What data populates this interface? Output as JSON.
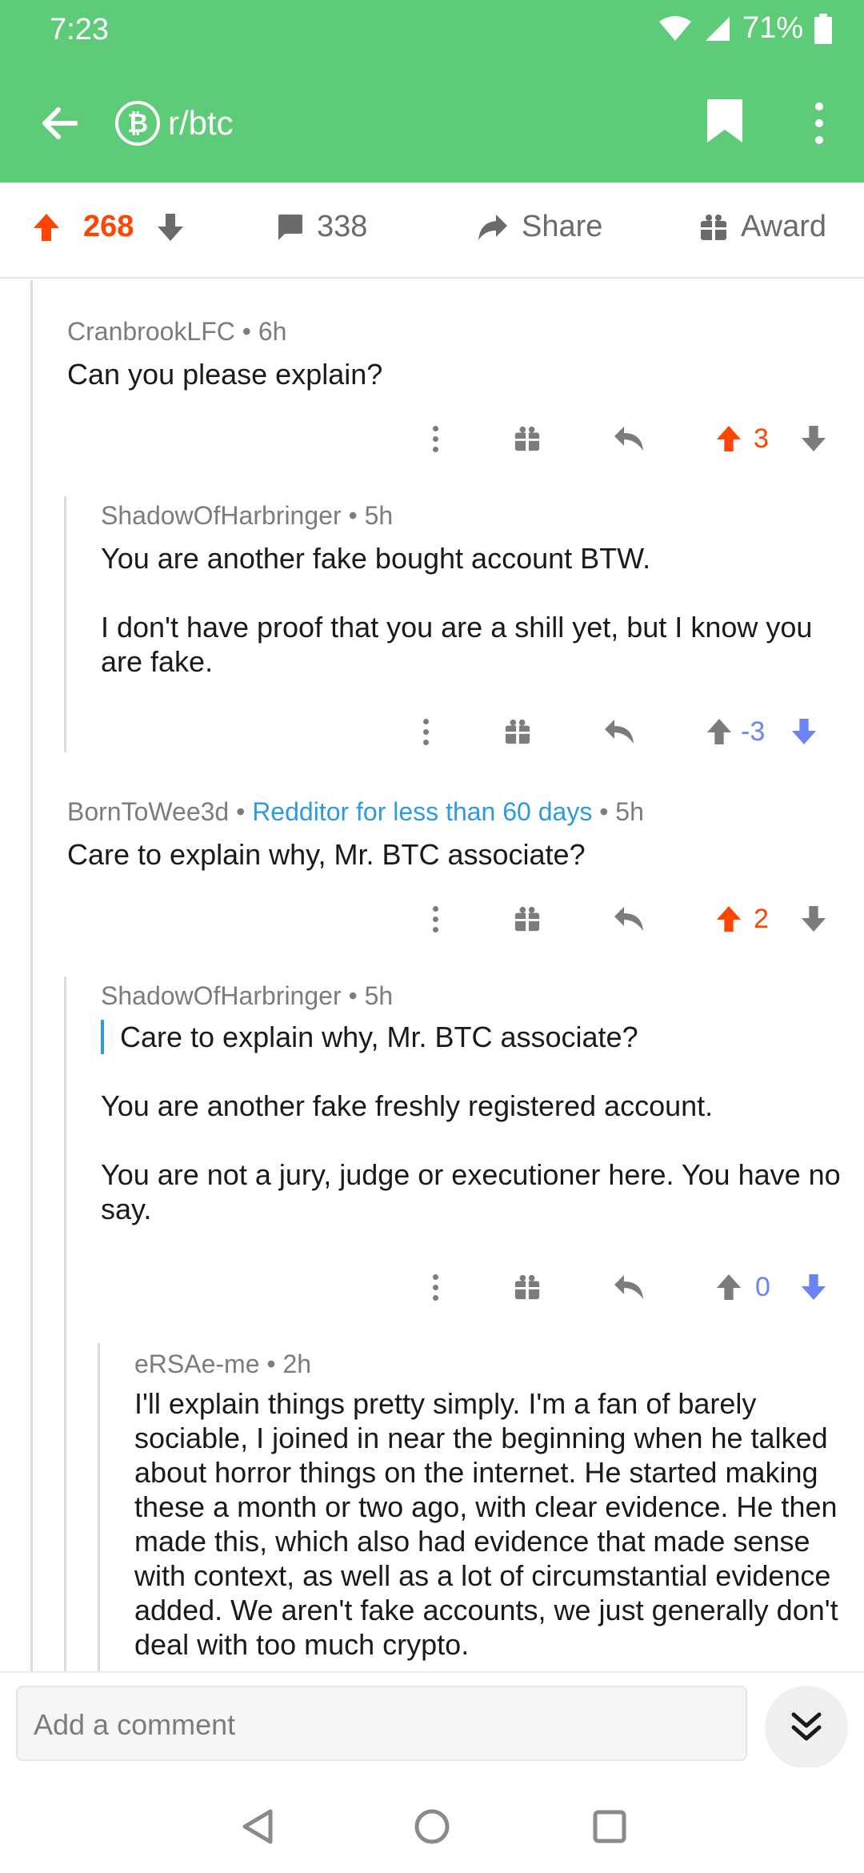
{
  "status_bar": {
    "time": "7:23",
    "battery": "71%"
  },
  "app_bar": {
    "subreddit": "r/btc",
    "subreddit_icon_glyph": "₿"
  },
  "post_bar": {
    "score": "268",
    "comments": "338",
    "share": "Share",
    "award": "Award"
  },
  "comments": [
    {
      "author": "CranbrookLFC",
      "age": "6h",
      "flair": "",
      "paragraphs": [
        "Can you please explain?"
      ],
      "quote": "",
      "score": "3",
      "vote": "up"
    },
    {
      "author": "ShadowOfHarbringer",
      "age": "5h",
      "flair": "",
      "paragraphs": [
        "You are another fake bought account BTW.",
        "I don't have proof that you are a shill yet, but I know you are fake."
      ],
      "quote": "",
      "score": "-3",
      "vote": "down"
    },
    {
      "author": "BornToWee3d",
      "age": "5h",
      "flair": "Redditor for less than 60 days",
      "paragraphs": [
        "Care to explain why, Mr. BTC associate?"
      ],
      "quote": "",
      "score": "2",
      "vote": "up"
    },
    {
      "author": "ShadowOfHarbringer",
      "age": "5h",
      "flair": "",
      "quote": "Care to explain why, Mr. BTC associate?",
      "paragraphs": [
        "You are another fake freshly registered account.",
        "You are not a jury, judge or executioner here. You have no say."
      ],
      "score": "0",
      "vote": "down"
    },
    {
      "author": "eRSAe-me",
      "age": "2h",
      "flair": "",
      "quote": "",
      "paragraphs": [
        "I'll explain things pretty simply. I'm a fan of barely sociable, I joined in near the beginning when he talked about horror things on the internet. He started making these a month or two ago, with clear evidence. He then made this, which also had evidence that made sense with context, as well as a lot of circumstantial evidence added. We aren't fake accounts, we just generally don't deal with too much crypto."
      ],
      "score": "",
      "vote": ""
    }
  ],
  "composer": {
    "placeholder": "Add a comment"
  },
  "colors": {
    "header": "#5ecb78",
    "upvote": "#ff4500",
    "downvote": "#6a83f5",
    "flair": "#2f9bd9",
    "neutral": "#7c7c7c"
  },
  "icons": [
    "back-arrow-icon",
    "bitcoin-icon",
    "bookmark-icon",
    "more-vertical-icon",
    "upvote-arrow-icon",
    "downvote-arrow-icon",
    "comment-bubble-icon",
    "share-arrow-icon",
    "gift-icon",
    "reply-icon",
    "chevron-double-down-icon",
    "nav-back-icon",
    "nav-home-icon",
    "nav-recents-icon"
  ]
}
